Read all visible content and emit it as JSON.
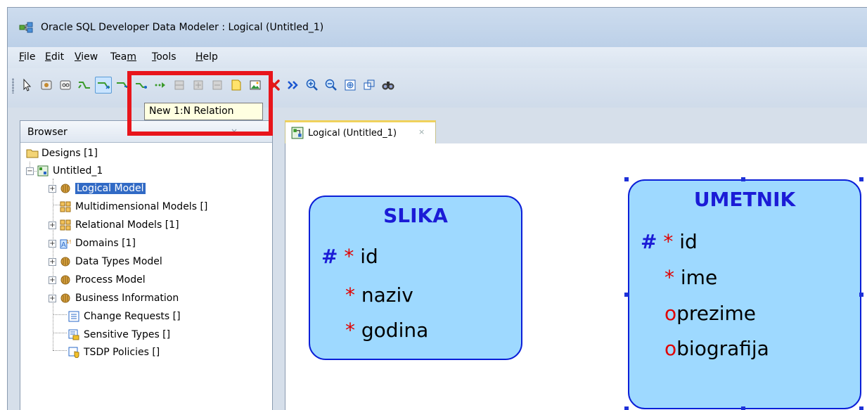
{
  "window": {
    "title": "Oracle SQL Developer Data Modeler : Logical (Untitled_1)"
  },
  "menu": [
    {
      "pre": "",
      "u": "F",
      "post": "ile"
    },
    {
      "pre": "",
      "u": "E",
      "post": "dit"
    },
    {
      "pre": "",
      "u": "V",
      "post": "iew"
    },
    {
      "pre": "Tea",
      "u": "m",
      "post": ""
    },
    {
      "pre": "",
      "u": "T",
      "post": "ools"
    },
    {
      "pre": "",
      "u": "H",
      "post": "elp"
    }
  ],
  "toolbar": {
    "tooltip": "New 1:N Relation",
    "buttons": [
      "select-icon",
      "new-entity-icon",
      "new-view-icon",
      "new-mn-relation-icon",
      "new-1n-relation-icon",
      "new-1n-identifying-relation-icon",
      "new-11-relation-icon",
      "new-type-substitution-icon",
      "new-arc-icon",
      "add-element-to-arc-icon",
      "remove-element-from-arc-icon",
      "new-note-icon",
      "new-picture-icon",
      "delete-icon",
      "engineer-icon",
      "zoom-in-icon",
      "zoom-out-icon",
      "fit-screen-icon",
      "default-size-icon",
      "find-icon"
    ],
    "accent": "#e8151b"
  },
  "browser": {
    "title": "Browser",
    "close_glyph": "×",
    "tree": [
      {
        "label": "Designs [1]",
        "icon": "folder-icon"
      },
      {
        "label": "Untitled_1",
        "icon": "design-icon"
      },
      {
        "label": "Logical Model",
        "icon": "logical-model-icon"
      },
      {
        "label": "Multidimensional Models []",
        "icon": "multidimensional-models-icon"
      },
      {
        "label": "Relational Models [1]",
        "icon": "relational-models-icon"
      },
      {
        "label": "Domains [1]",
        "icon": "domains-icon"
      },
      {
        "label": "Data Types Model",
        "icon": "data-types-model-icon"
      },
      {
        "label": "Process Model",
        "icon": "process-model-icon"
      },
      {
        "label": "Business Information",
        "icon": "business-information-icon"
      },
      {
        "label": "Change Requests []",
        "icon": "change-requests-icon"
      },
      {
        "label": "Sensitive Types []",
        "icon": "sensitive-types-icon"
      },
      {
        "label": "TSDP Policies []",
        "icon": "tsdp-policies-icon"
      }
    ]
  },
  "editor": {
    "tab_label": "Logical (Untitled_1)",
    "tab_close": "×",
    "entities": [
      {
        "name": "SLIKA",
        "attributes": [
          {
            "key": "#",
            "marker": "*",
            "name": "id"
          },
          {
            "key": "",
            "marker": "*",
            "name": "naziv"
          },
          {
            "key": "",
            "marker": "*",
            "name": "godina"
          }
        ]
      },
      {
        "name": "UMETNIK",
        "attributes": [
          {
            "key": "#",
            "marker": "*",
            "name": "id"
          },
          {
            "key": "",
            "marker": "*",
            "name": "ime"
          },
          {
            "key": "",
            "marker": "o",
            "name": "prezime"
          },
          {
            "key": "",
            "marker": "o",
            "name": "biografija"
          }
        ]
      }
    ],
    "colors": {
      "entity_fill": "#9ed9ff",
      "entity_border": "#0b1fd8",
      "title": "#1b1bd6",
      "mandatory": "#e00000"
    }
  }
}
